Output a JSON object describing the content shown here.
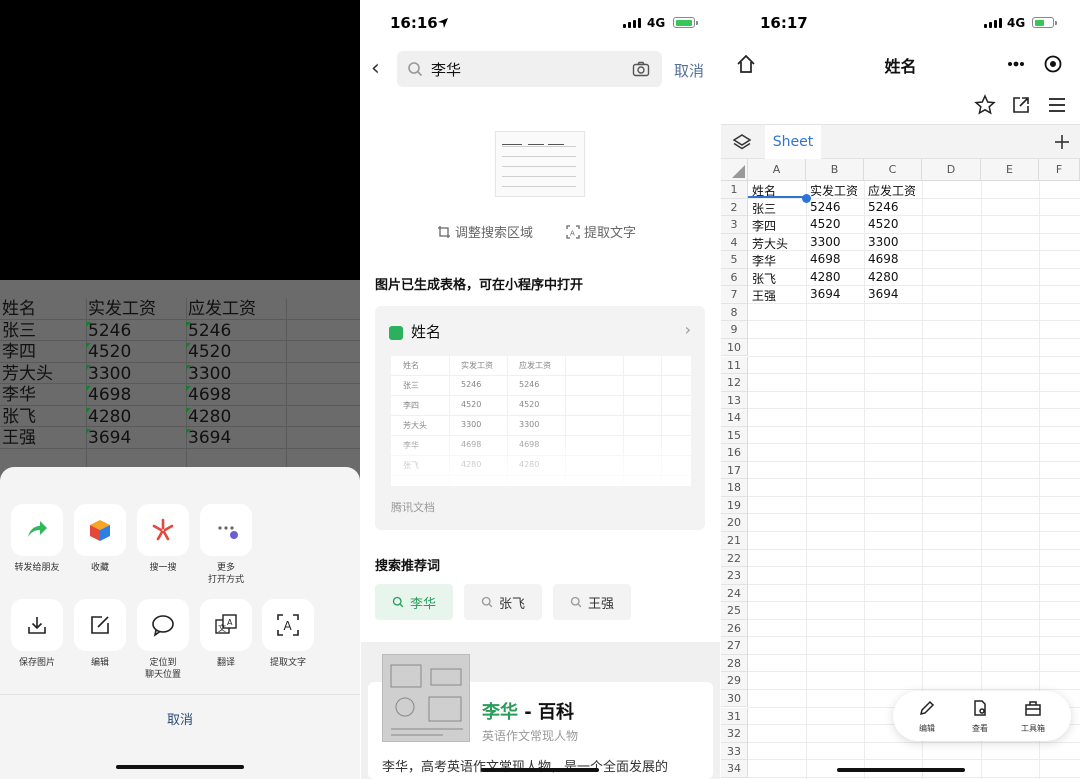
{
  "panel1": {
    "table": {
      "headers": [
        "姓名",
        "实发工资",
        "应发工资"
      ],
      "rows": [
        [
          "张三",
          "5246",
          "5246"
        ],
        [
          "李四",
          "4520",
          "4520"
        ],
        [
          "芳大头",
          "3300",
          "3300"
        ],
        [
          "李华",
          "4698",
          "4698"
        ],
        [
          "张飞",
          "4280",
          "4280"
        ],
        [
          "王强",
          "3694",
          "3694"
        ]
      ]
    },
    "share_sheet": {
      "row1": [
        {
          "label": "转发给朋友",
          "icon": "forward-arrow-icon"
        },
        {
          "label": "收藏",
          "icon": "favorite-cube-icon"
        },
        {
          "label": "搜一搜",
          "icon": "search-star-icon"
        },
        {
          "label": "更多\n打开方式",
          "icon": "more-options-icon"
        }
      ],
      "row2": [
        {
          "label": "保存图片",
          "icon": "download-icon"
        },
        {
          "label": "编辑",
          "icon": "edit-icon"
        },
        {
          "label": "定位到\n聊天位置",
          "icon": "chat-bubble-icon"
        },
        {
          "label": "翻译",
          "icon": "translate-icon"
        },
        {
          "label": "提取文字",
          "icon": "extract-text-icon"
        }
      ],
      "cancel": "取消"
    }
  },
  "panel2": {
    "status": {
      "time": "16:16",
      "network": "4G"
    },
    "search": {
      "query": "李华",
      "cancel": "取消"
    },
    "tools": {
      "adjust": "调整搜索区域",
      "extract": "提取文字"
    },
    "generated_notice": "图片已生成表格，可在小程序中打开",
    "doc_card": {
      "title": "姓名",
      "source": "腾讯文档",
      "headers": [
        "姓名",
        "实发工资",
        "应发工资"
      ],
      "rows": [
        [
          "张三",
          "5246",
          "5246"
        ],
        [
          "李四",
          "4520",
          "4520"
        ],
        [
          "芳大头",
          "3300",
          "3300"
        ],
        [
          "李华",
          "4698",
          "4698"
        ],
        [
          "张飞",
          "4280",
          "4280"
        ]
      ]
    },
    "recommend": {
      "title": "搜索推荐词",
      "chips": [
        "李华",
        "张飞",
        "王强"
      ]
    },
    "result": {
      "title_highlight": "李华",
      "title_rest": " - 百科",
      "subtitle": "英语作文常现人物",
      "body": "李华，高考英语作文常现人物，是一个全面发展的"
    }
  },
  "panel3": {
    "status": {
      "time": "16:17",
      "network": "4G"
    },
    "title": "姓名",
    "sheet_tab": "Sheet",
    "columns": [
      "A",
      "B",
      "C",
      "D",
      "E",
      "F"
    ],
    "row_numbers": [
      "1",
      "2",
      "3",
      "4",
      "5",
      "6",
      "7",
      "8",
      "9",
      "10",
      "11",
      "12",
      "13",
      "14",
      "15",
      "16",
      "17",
      "18",
      "19",
      "20",
      "21",
      "22",
      "23",
      "24",
      "25",
      "26",
      "27",
      "28",
      "29",
      "30",
      "31",
      "32",
      "33",
      "34"
    ],
    "cells": [
      [
        "姓名",
        "实发工资",
        "应发工资"
      ],
      [
        "张三",
        "5246",
        "5246"
      ],
      [
        "李四",
        "4520",
        "4520"
      ],
      [
        "芳大头",
        "3300",
        "3300"
      ],
      [
        "李华",
        "4698",
        "4698"
      ],
      [
        "张飞",
        "4280",
        "4280"
      ],
      [
        "王强",
        "3694",
        "3694"
      ]
    ],
    "float_toolbar": [
      {
        "label": "编辑",
        "icon": "pencil-icon"
      },
      {
        "label": "查看",
        "icon": "view-doc-icon"
      },
      {
        "label": "工具箱",
        "icon": "toolbox-icon"
      }
    ],
    "colors": {
      "accent": "#2d74d6",
      "green": "#2a9d5a"
    }
  }
}
